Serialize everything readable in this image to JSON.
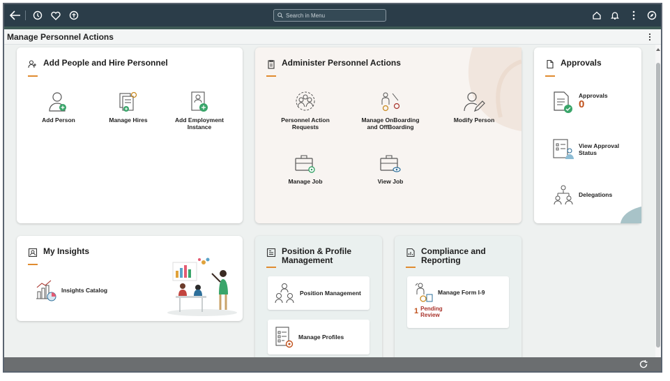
{
  "topbar": {
    "search_placeholder": "Search in Menu"
  },
  "page": {
    "title": "Manage Personnel Actions"
  },
  "tiles": {
    "add_people": {
      "title": "Add People and Hire Personnel",
      "items": [
        "Add Person",
        "Manage Hires",
        "Add Employment Instance"
      ]
    },
    "administer": {
      "title": "Administer Personnel Actions",
      "items": [
        "Personnel Action Requests",
        "Manage OnBoarding and OffBoarding",
        "Modify Person",
        "Manage Job",
        "View Job"
      ]
    },
    "approvals": {
      "title": "Approvals",
      "approvals_label": "Approvals",
      "approvals_count": "0",
      "view_status": "View Approval Status",
      "delegations": "Delegations"
    },
    "insights": {
      "title": "My Insights",
      "catalog": "Insights Catalog"
    },
    "position": {
      "title_line1": "Position & Profile",
      "title_line2": "Management",
      "position_mgmt": "Position Management",
      "manage_profiles": "Manage Profiles"
    },
    "compliance": {
      "title_line1": "Compliance and",
      "title_line2": "Reporting",
      "form_i9": "Manage Form I-9",
      "pending_count": "1",
      "pending_line1": "Pending",
      "pending_line2": "Review"
    }
  },
  "colors": {
    "topbar": "#2b3d49",
    "accent_orange": "#e08b2f",
    "count_orange": "#c0501a",
    "pending_red": "#a8322a",
    "icon_green": "#3aa56a"
  },
  "icons": [
    "back-arrow-icon",
    "history-icon",
    "favorites-icon",
    "navbar-icon",
    "search-icon",
    "home-icon",
    "notification-icon",
    "actions-menu-icon",
    "compass-icon",
    "refresh-icon"
  ]
}
